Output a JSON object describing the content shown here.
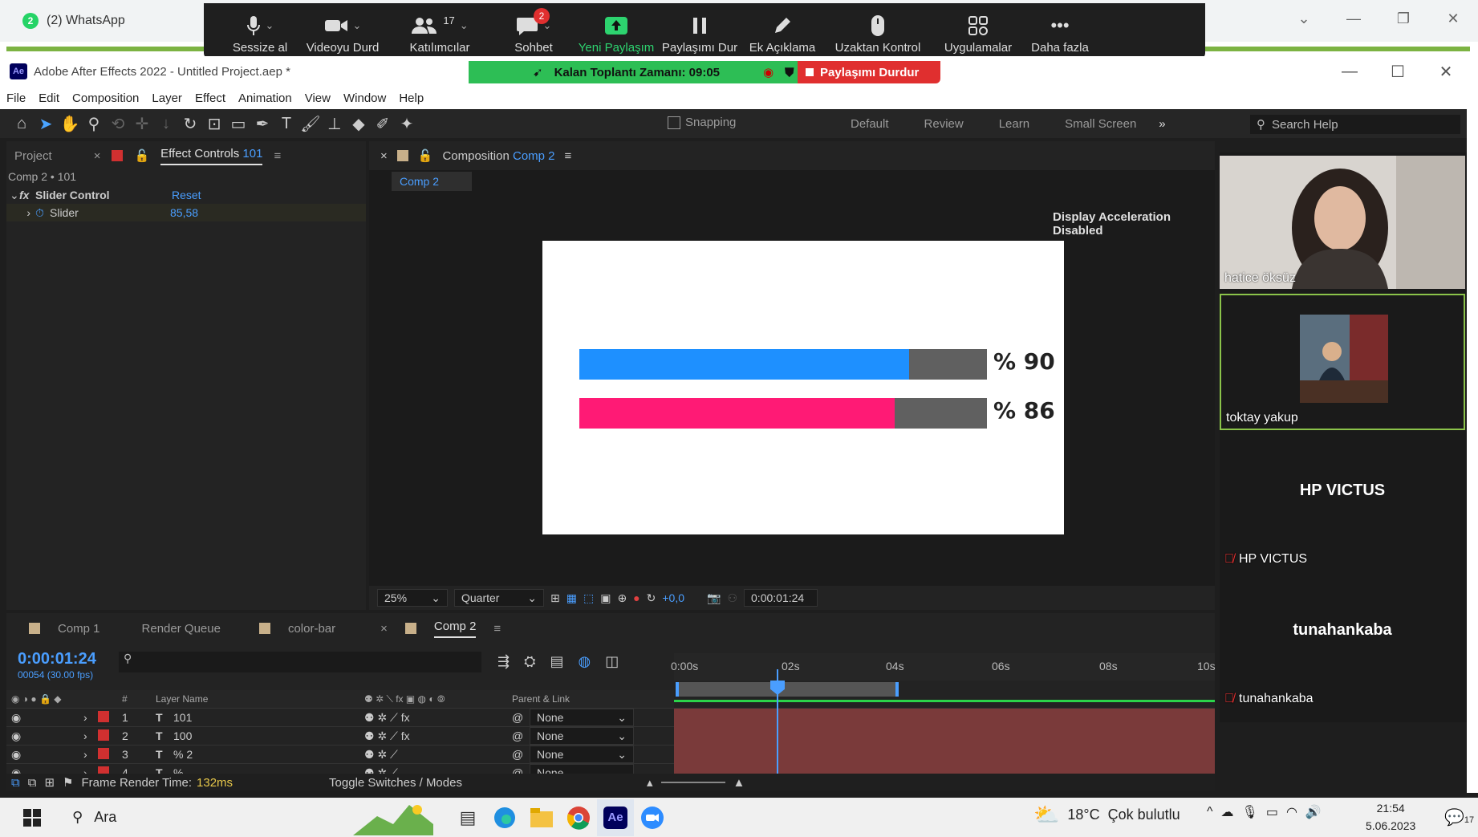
{
  "browser": {
    "tab_title": "(2) WhatsApp",
    "tab_badge": "2"
  },
  "zoom_toolbar": {
    "buttons": [
      {
        "label": "Sessize al"
      },
      {
        "label": "Videoyu Durd"
      },
      {
        "label": "Katılımcılar",
        "count": "17"
      },
      {
        "label": "Sohbet",
        "badge": "2"
      },
      {
        "label": "Yeni Paylaşım"
      },
      {
        "label": "Paylaşımı Dur"
      },
      {
        "label": "Ek Açıklama"
      },
      {
        "label": "Uzaktan Kontrol"
      },
      {
        "label": "Uygulamalar"
      },
      {
        "label": "Daha fazla"
      }
    ],
    "meeting_timer": "Kalan Toplantı Zamanı: 09:05",
    "stop_share": "Paylaşımı Durdur"
  },
  "ae": {
    "window_title": "Adobe After Effects 2022 - Untitled Project.aep *",
    "logo": "Ae",
    "menu": [
      "File",
      "Edit",
      "Composition",
      "Layer",
      "Effect",
      "Animation",
      "View",
      "Window",
      "Help"
    ],
    "snapping": "Snapping",
    "workspaces": [
      "Default",
      "Review",
      "Learn",
      "Small Screen"
    ],
    "search_help": "Search Help",
    "left_panel": {
      "tab_project": "Project",
      "tab_effect": "Effect Controls",
      "tab_effect_layer": "101",
      "subtitle": "Comp 2 • 101",
      "effect_name": "Slider Control",
      "reset": "Reset",
      "param_name": "Slider",
      "param_value": "85,58"
    },
    "comp_panel": {
      "tab_label": "Composition",
      "tab_comp": "Comp 2",
      "sub_tab": "Comp 2",
      "notice": "Display Acceleration Disabled",
      "bars": [
        {
          "color": "#1e90ff",
          "fill": 0.9,
          "label": "% 90"
        },
        {
          "color": "#ff1a75",
          "fill": 0.86,
          "label": "% 86"
        }
      ],
      "zoom": "25%",
      "resolution": "Quarter",
      "exposure": "+0,0",
      "timecode": "0:00:01:24"
    },
    "timeline": {
      "tabs": [
        "Comp 1",
        "Render Queue",
        "color-bar",
        "Comp 2"
      ],
      "timecode": "0:00:01:24",
      "frame_info": "00054 (30.00 fps)",
      "col_hash": "#",
      "col_layer_name": "Layer Name",
      "col_parent": "Parent & Link",
      "ruler": [
        "0:00s",
        "02s",
        "04s",
        "06s",
        "08s",
        "10s"
      ],
      "layers": [
        {
          "num": "1",
          "name": "101",
          "parent": "None"
        },
        {
          "num": "2",
          "name": "100",
          "parent": "None"
        },
        {
          "num": "3",
          "name": "% 2",
          "parent": "None"
        },
        {
          "num": "4",
          "name": "%",
          "parent": "None"
        }
      ],
      "frame_render_label": "Frame Render Time:",
      "frame_render_value": "132ms",
      "toggle": "Toggle Switches / Modes"
    }
  },
  "participants": [
    {
      "name": "hatice öksüz",
      "type": "video"
    },
    {
      "name": "toktay yakup",
      "type": "video"
    },
    {
      "name": "HP VICTUS",
      "type": "name",
      "muted": true
    },
    {
      "name": "tunahankaba",
      "type": "name",
      "muted": true
    }
  ],
  "taskbar": {
    "search": "Ara",
    "weather_temp": "18°C",
    "weather_desc": "Çok bulutlu",
    "time": "21:54",
    "date": "5.06.2023",
    "notif": "17"
  },
  "colors": {
    "accent_blue": "#4a9eff",
    "zoom_green": "#2dbe55",
    "zoom_red": "#e02f2f",
    "track_red": "#7a3a3a"
  }
}
